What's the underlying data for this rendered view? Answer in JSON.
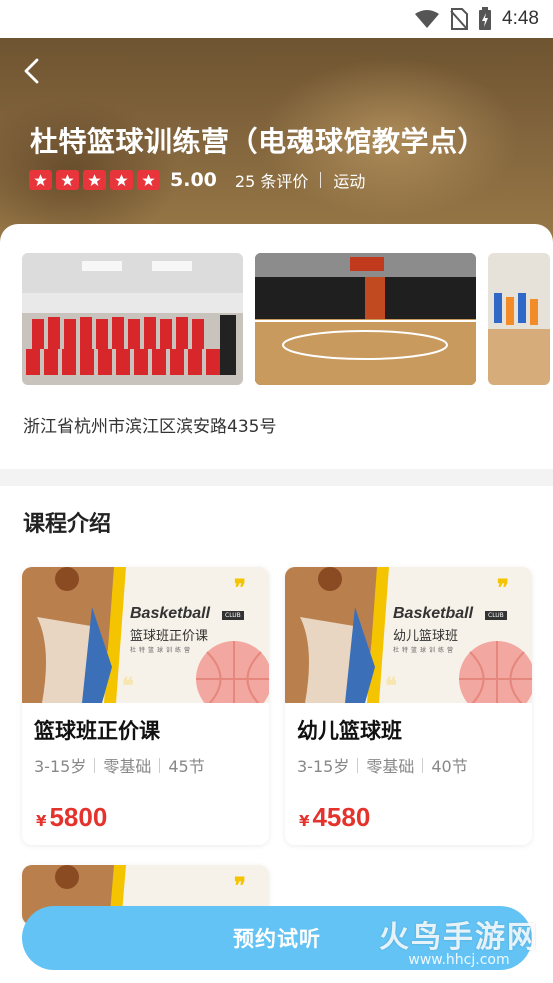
{
  "status_bar": {
    "time": "4:48"
  },
  "header": {
    "title": "杜特篮球训练营（电魂球馆教学点）",
    "rating": "5.00",
    "reviews": "25 条评价",
    "category": "运动"
  },
  "venue": {
    "address": "浙江省杭州市滨江区滨安路435号",
    "photos": [
      "group-photo",
      "court-photo",
      "training-photo"
    ]
  },
  "courses_section": {
    "title": "课程介绍",
    "courses": [
      {
        "name": "篮球班正价课",
        "age": "3-15岁",
        "level": "零基础",
        "lessons": "45节",
        "currency": "¥",
        "price": "5800",
        "banner_title": "Basketball",
        "banner_tag": "CLUB",
        "banner_sub": "篮球班正价课",
        "banner_tiny": "杜特篮球训练营"
      },
      {
        "name": "幼儿篮球班",
        "age": "3-15岁",
        "level": "零基础",
        "lessons": "40节",
        "currency": "¥",
        "price": "4580",
        "banner_title": "Basketball",
        "banner_tag": "CLUB",
        "banner_sub": "幼儿篮球班",
        "banner_tiny": "杜特篮球训练营"
      }
    ]
  },
  "cta": {
    "label": "预约试听"
  },
  "watermark": {
    "brand": "火鸟手游网",
    "url": "www.hhcj.com"
  },
  "colors": {
    "accent": "#62c3f4",
    "price": "#e4322c",
    "star": "#e8343b"
  }
}
